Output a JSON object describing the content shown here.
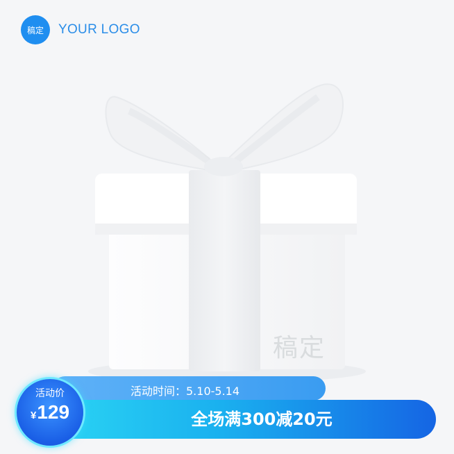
{
  "logo": {
    "badge": "稿定",
    "text": "YOUR LOGO"
  },
  "watermark": "稿定",
  "promo": {
    "activity_time": "活动时间：5.10-5.14",
    "headline": "全场满300减20元",
    "price_label": "活动价",
    "currency": "¥",
    "price": "129"
  },
  "colors": {
    "brand_blue": "#1f8ef0",
    "headline_gradient_start": "#2bd6f4",
    "headline_gradient_end": "#1565e4",
    "gift_white": "#ffffff"
  },
  "icons": [
    "gift-box-image"
  ]
}
